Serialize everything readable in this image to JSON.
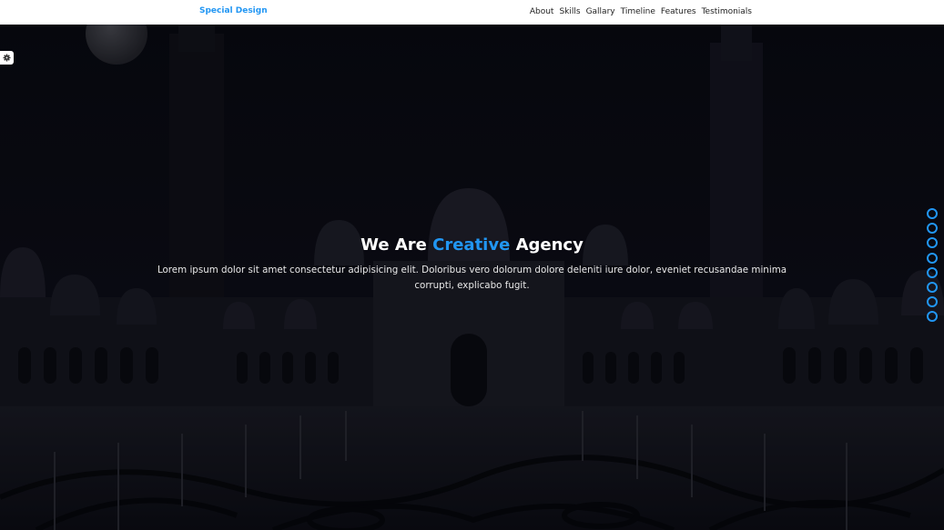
{
  "header": {
    "logo": "Special Design",
    "nav": [
      "About",
      "Skills",
      "Gallary",
      "Timeline",
      "Features",
      "Testimonials"
    ]
  },
  "hero": {
    "title_before": "We Are ",
    "title_accent": "Creative",
    "title_after": " Agency",
    "description": "Lorem ipsum dolor sit amet consectetur adipisicing elit. Doloribus vero dolorum dolore deleniti iure dolor, eveniet recusandae minima corrupti, explicabo fugit."
  },
  "bullets_count": 8,
  "colors": {
    "accent": "#2196f3",
    "background": "#07080f",
    "header": "#ffffff"
  },
  "icons": {
    "settings": "gear-icon"
  }
}
